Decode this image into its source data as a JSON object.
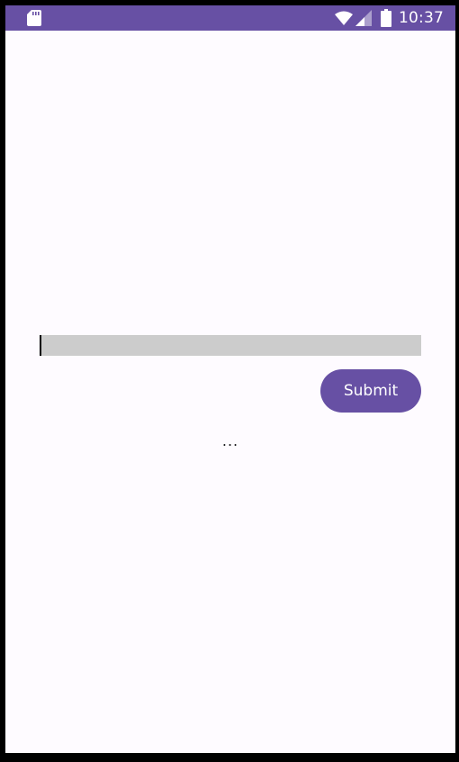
{
  "status_bar": {
    "time": "10:37",
    "icons": [
      "sd-card-icon",
      "wifi-icon",
      "cell-signal-icon",
      "battery-icon"
    ],
    "background": "#6750a4"
  },
  "form": {
    "input_value": "",
    "input_placeholder": "",
    "submit_label": "Submit"
  },
  "result": {
    "text": "..."
  },
  "colors": {
    "accent": "#6750a4",
    "surface": "#fefbff",
    "input_background": "#cccccc"
  }
}
